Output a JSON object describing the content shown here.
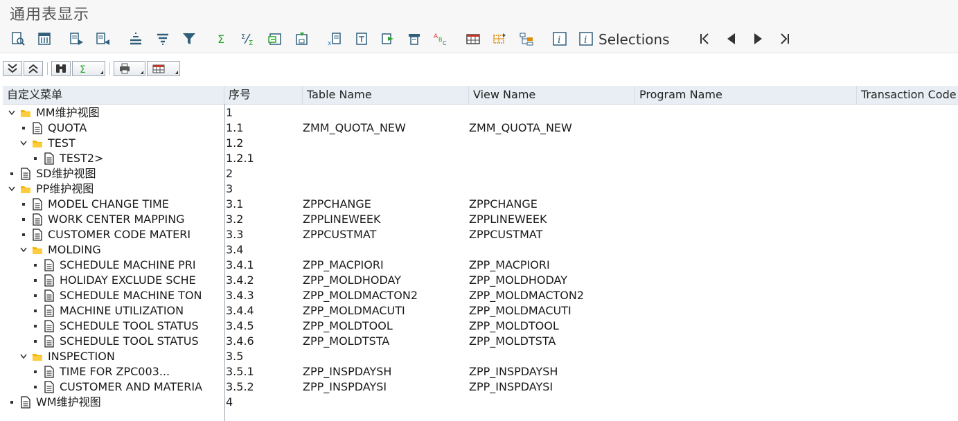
{
  "window": {
    "title": "通用表显示"
  },
  "toolbar": {
    "icons": [
      "execute-doc-icon",
      "calculator-icon",
      "list-arrow-icon",
      "list-arrow-2-icon",
      "align-center-icon",
      "sort-icon",
      "filter-icon",
      "sum-icon",
      "subtotal-icon",
      "export-icon",
      "save-icon",
      "excel-icon",
      "word-icon",
      "send-icon",
      "print-icon",
      "spellcheck-icon",
      "table-layout-icon",
      "grid-change-icon",
      "hierarchy-icon",
      "info-icon",
      "info-selections-icon"
    ],
    "selections_label": "Selections",
    "nav": [
      "first-page-icon",
      "prev-page-icon",
      "next-page-icon",
      "last-page-icon"
    ]
  },
  "toolbar2": {
    "buttons": [
      "expand-all-icon",
      "collapse-all-icon",
      "find-icon",
      "sum-menu-icon",
      "print-menu-icon",
      "layout-menu-icon"
    ]
  },
  "columns": {
    "menu": "自定义菜单",
    "seq": "序号",
    "table": "Table Name",
    "view": "View Name",
    "program": "Program Name",
    "tcode": "Transaction Code"
  },
  "rows": [
    {
      "label": "MM维护视图",
      "seq": "1",
      "table": "",
      "view": "",
      "type": "folder",
      "expanded": true
    },
    {
      "label": "QUOTA",
      "seq": "1.1",
      "table": "ZMM_QUOTA_NEW",
      "view": "ZMM_QUOTA_NEW",
      "type": "doc"
    },
    {
      "label": "TEST",
      "seq": "1.2",
      "table": "",
      "view": "",
      "type": "folder",
      "expanded": true
    },
    {
      "label": "TEST2>",
      "seq": "1.2.1",
      "table": "",
      "view": "",
      "type": "doc"
    },
    {
      "label": "SD维护视图",
      "seq": "2",
      "table": "",
      "view": "",
      "type": "doc"
    },
    {
      "label": "PP维护视图",
      "seq": "3",
      "table": "",
      "view": "",
      "type": "folder",
      "expanded": true
    },
    {
      "label": "MODEL CHANGE TIME",
      "seq": "3.1",
      "table": "ZPPCHANGE",
      "view": "ZPPCHANGE",
      "type": "doc"
    },
    {
      "label": "WORK CENTER MAPPING",
      "seq": "3.2",
      "table": "ZPPLINEWEEK",
      "view": "ZPPLINEWEEK",
      "type": "doc"
    },
    {
      "label": "CUSTOMER CODE MATERI",
      "seq": "3.3",
      "table": "ZPPCUSTMAT",
      "view": "ZPPCUSTMAT",
      "type": "doc"
    },
    {
      "label": "MOLDING",
      "seq": "3.4",
      "table": "",
      "view": "",
      "type": "folder",
      "expanded": true
    },
    {
      "label": "SCHEDULE MACHINE PRI",
      "seq": "3.4.1",
      "table": "ZPP_MACPIORI",
      "view": "ZPP_MACPIORI",
      "type": "doc"
    },
    {
      "label": "HOLIDAY EXCLUDE SCHE",
      "seq": "3.4.2",
      "table": "ZPP_MOLDHODAY",
      "view": "ZPP_MOLDHODAY",
      "type": "doc"
    },
    {
      "label": "SCHEDULE MACHINE TON",
      "seq": "3.4.3",
      "table": "ZPP_MOLDMACTON2",
      "view": "ZPP_MOLDMACTON2",
      "type": "doc"
    },
    {
      "label": "MACHINE UTILIZATION",
      "seq": "3.4.4",
      "table": "ZPP_MOLDMACUTI",
      "view": "ZPP_MOLDMACUTI",
      "type": "doc"
    },
    {
      "label": "SCHEDULE TOOL STATUS",
      "seq": "3.4.5",
      "table": "ZPP_MOLDTOOL",
      "view": "ZPP_MOLDTOOL",
      "type": "doc"
    },
    {
      "label": "SCHEDULE TOOL STATUS",
      "seq": "3.4.6",
      "table": "ZPP_MOLDTSTA",
      "view": "ZPP_MOLDTSTA",
      "type": "doc"
    },
    {
      "label": "INSPECTION",
      "seq": "3.5",
      "table": "",
      "view": "",
      "type": "folder",
      "expanded": true
    },
    {
      "label": "TIME FOR ZPC003...",
      "seq": "3.5.1",
      "table": "ZPP_INSPDAYSH",
      "view": "ZPP_INSPDAYSH",
      "type": "doc"
    },
    {
      "label": "CUSTOMER AND MATERIA",
      "seq": "3.5.2",
      "table": "ZPP_INSPDAYSI",
      "view": "ZPP_INSPDAYSI",
      "type": "doc"
    },
    {
      "label": "WM维护视图",
      "seq": "4",
      "table": "",
      "view": "",
      "type": "doc"
    }
  ],
  "colors": {
    "folder": "#f4b400",
    "header_bg": "#e8eef3",
    "toolbar_bg": "#f7f7f7",
    "icon": "#2f5f7a",
    "icon_accent": "#2aa52a"
  }
}
